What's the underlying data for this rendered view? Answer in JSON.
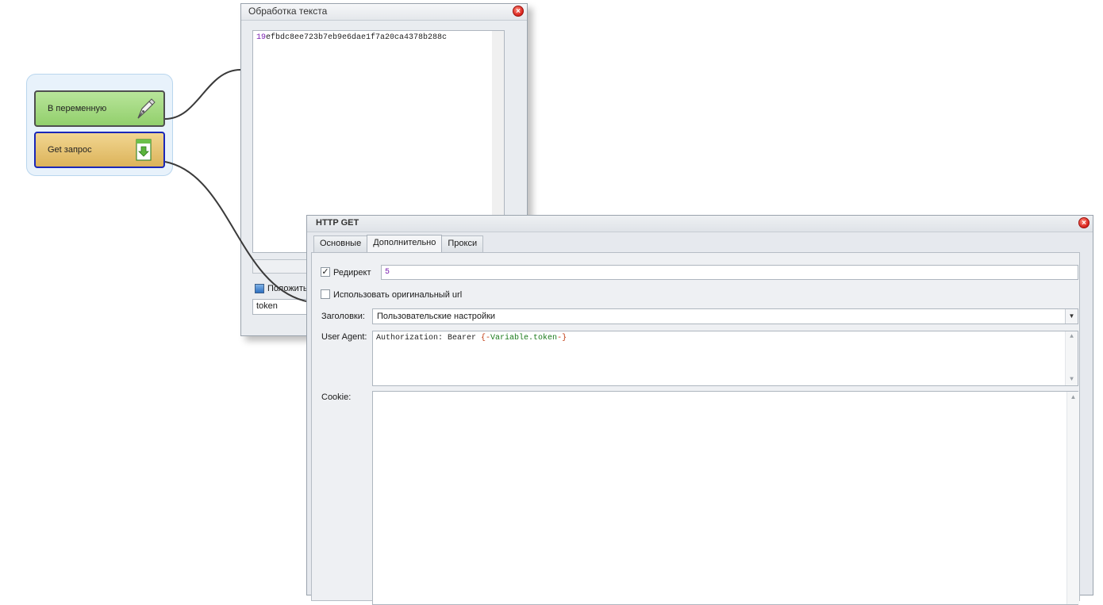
{
  "flow": {
    "block_variable": {
      "label": "В переменную",
      "icon": "pen-nib-icon"
    },
    "block_get": {
      "label": "Get запрос",
      "icon": "download-arrow-icon"
    }
  },
  "text_window": {
    "title": "Обработка текста",
    "content_prefix": "19",
    "content_rest": "efbdc8ee723b7eb9e6dae1f7a20ca4378b288c",
    "save_checkbox_label": "Положить",
    "variable_name": "token"
  },
  "http_window": {
    "title": "HTTP GET",
    "tabs": [
      "Основные",
      "Дополнительно",
      "Прокси"
    ],
    "active_tab": "Дополнительно",
    "redirect": {
      "label": "Редирект",
      "checked": true,
      "value": "5"
    },
    "use_original_url": {
      "label": "Использовать оригинальный url",
      "checked": false
    },
    "headers": {
      "label": "Заголовки:",
      "value": "Пользовательские настройки"
    },
    "user_agent": {
      "label": "User Agent:",
      "prefix": "Authorization: Bearer ",
      "open": "{-",
      "var": "Variable.token",
      "close": "-}"
    },
    "cookie": {
      "label": "Cookie:",
      "value": ""
    }
  },
  "colors": {
    "variable_block": "#a5da82",
    "get_block": "#e6c475",
    "get_block_border": "#1a27b8",
    "close_button": "#d8201a"
  }
}
